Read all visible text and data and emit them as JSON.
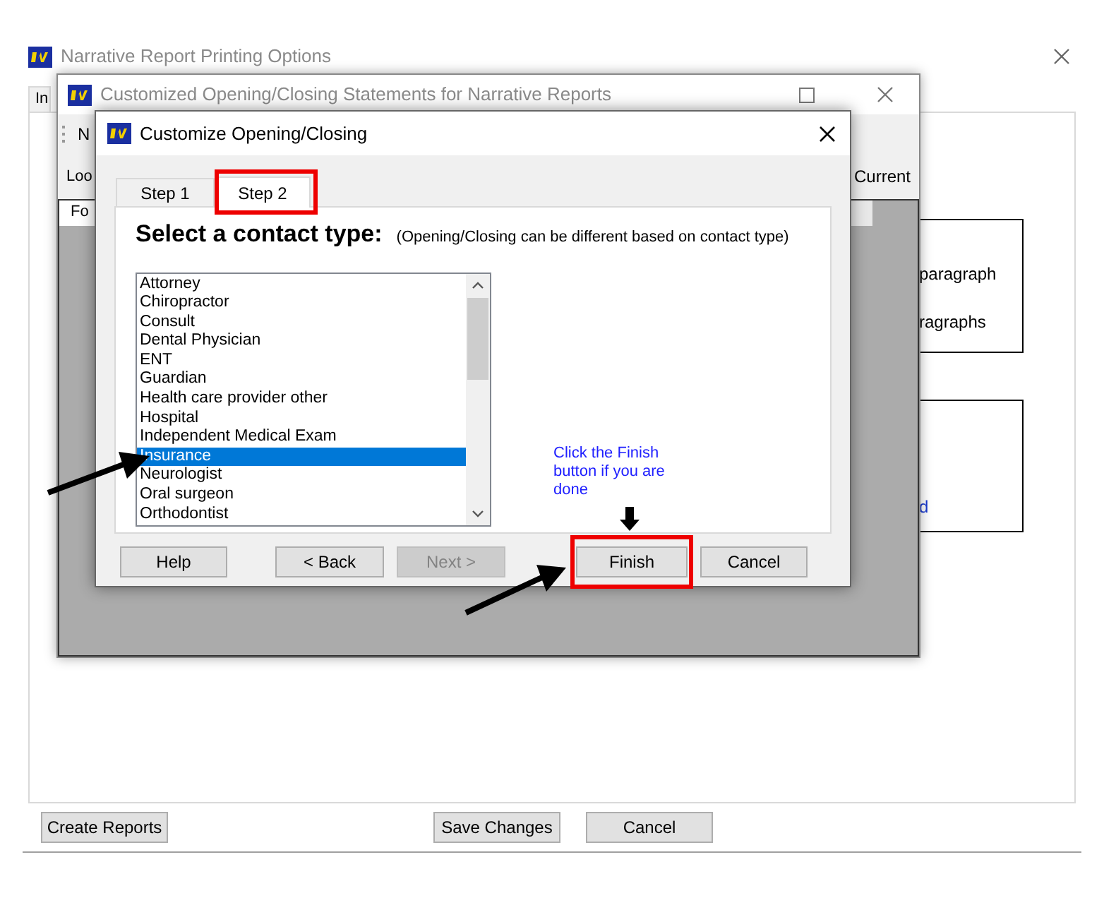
{
  "back_window": {
    "title": "Narrative Report Printing Options",
    "tab": "In",
    "side_texts": [
      "paragraph",
      "ragraphs"
    ],
    "link_text": "d",
    "buttons": [
      "Create Reports",
      "Save Changes",
      "Cancel"
    ]
  },
  "middle_window": {
    "title": "Customized Opening/Closing Statements for Narrative Reports",
    "toolbar_text": "N",
    "left_label": "Loo",
    "right_label": "Current",
    "tab": "Fo"
  },
  "dialog": {
    "title": "Customize Opening/Closing",
    "tabs": [
      {
        "label": "Step 1",
        "selected": false
      },
      {
        "label": "Step 2",
        "selected": true
      }
    ],
    "heading": "Select a contact type:",
    "note": "(Opening/Closing can be different based on contact type)",
    "contact_types": [
      {
        "label": "Attorney",
        "selected": false
      },
      {
        "label": "Chiropractor",
        "selected": false
      },
      {
        "label": "Consult",
        "selected": false
      },
      {
        "label": "Dental Physician",
        "selected": false
      },
      {
        "label": "ENT",
        "selected": false
      },
      {
        "label": "Guardian",
        "selected": false
      },
      {
        "label": "Health care provider other",
        "selected": false
      },
      {
        "label": "Hospital",
        "selected": false
      },
      {
        "label": "Independent Medical Exam",
        "selected": false
      },
      {
        "label": "Insurance",
        "selected": true
      },
      {
        "label": "Neurologist",
        "selected": false
      },
      {
        "label": "Oral surgeon",
        "selected": false
      },
      {
        "label": "Orthodontist",
        "selected": false
      }
    ],
    "hint": "Click the Finish button if you are done",
    "buttons": [
      {
        "label": "Help",
        "disabled": false
      },
      {
        "label": "< Back",
        "disabled": false
      },
      {
        "label": "Next >",
        "disabled": true
      },
      {
        "label": "Finish",
        "disabled": false
      },
      {
        "label": "Cancel",
        "disabled": false
      }
    ]
  }
}
